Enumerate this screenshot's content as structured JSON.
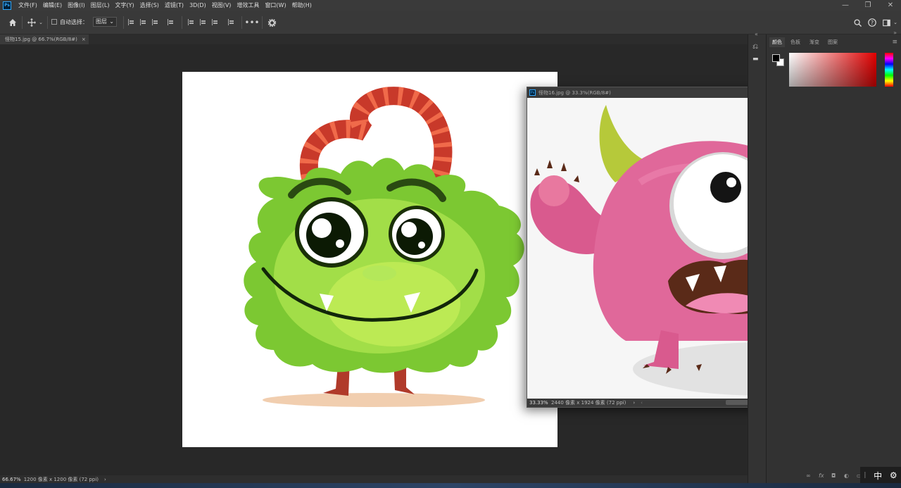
{
  "menubar": {
    "logo": "Ps",
    "items": [
      "文件(F)",
      "编辑(E)",
      "图像(I)",
      "图层(L)",
      "文字(Y)",
      "选择(S)",
      "滤镜(T)",
      "3D(D)",
      "视图(V)",
      "增效工具",
      "窗口(W)",
      "帮助(H)"
    ]
  },
  "options": {
    "auto_select_label": "自动选择：",
    "layer_select_value": "图层"
  },
  "document": {
    "tab_title": "怪物15.jpg @ 66.7%(RGB/8#)",
    "tab_close": "×",
    "zoom": "66.67%",
    "dimensions": "1200 像素 x 1200 像素 (72 ppi)"
  },
  "float_window": {
    "logo": "Ps",
    "title": "怪物16.jpg @ 33.3%(RGB/8#)",
    "zoom": "33.33%",
    "dimensions": "2440 像素 x 1924 像素 (72 ppi)"
  },
  "panel": {
    "tabs": [
      "颜色",
      "色板",
      "渐变",
      "图案"
    ]
  },
  "ime": {
    "label": "中"
  },
  "colors": {
    "green_monster": "#7cc832",
    "pink_monster": "#e0689a",
    "horn": "#b6c93a",
    "stripe_red": "#c8392a"
  }
}
